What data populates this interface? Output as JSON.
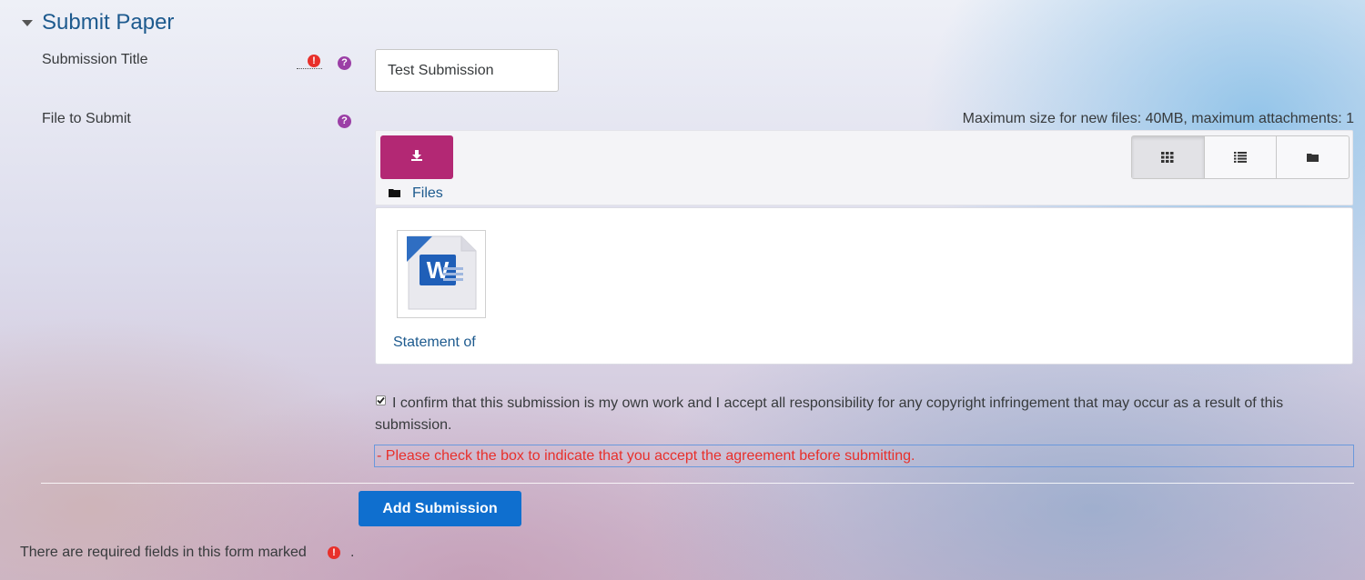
{
  "section": {
    "title": "Submit Paper",
    "toggle_icon": "caret-down-icon"
  },
  "submission_title": {
    "label": "Submission Title",
    "required_icon": "exclamation-circle-icon",
    "required_symbol": "!",
    "help_icon": "question-circle-icon",
    "help_symbol": "?",
    "value": "Test Submission"
  },
  "file_to_submit": {
    "label": "File to Submit",
    "help_icon": "question-circle-icon",
    "help_symbol": "?",
    "max_size_text": "Maximum size for new files: 40MB, maximum attachments: 1",
    "upload_icon": "download-icon",
    "folder_icon": "folder-icon",
    "files_link": "Files",
    "views": [
      {
        "icon": "grid-icon",
        "active": true
      },
      {
        "icon": "list-icon",
        "active": false
      },
      {
        "icon": "folder-icon",
        "active": false
      }
    ],
    "files": [
      {
        "name": "Statement of",
        "icon": "word-document-icon",
        "icon_letter": "W"
      }
    ]
  },
  "agreement": {
    "checked": true,
    "text": "I confirm that this submission is my own work and I accept all responsibility for any copyright infringement that may occur as a result of this submission.",
    "error": "- Please check the box to indicate that you accept the agreement before submitting."
  },
  "actions": {
    "submit_label": "Add Submission"
  },
  "footer": {
    "required_note": "There are required fields in this form marked",
    "required_symbol": "!",
    "period": "."
  },
  "colors": {
    "link": "#1d5a8e",
    "upload_button": "#b32874",
    "submit_button": "#0f6fcf",
    "error_text": "#e8302b",
    "required_icon": "#e8302b",
    "help_icon": "#9b3fa6"
  }
}
